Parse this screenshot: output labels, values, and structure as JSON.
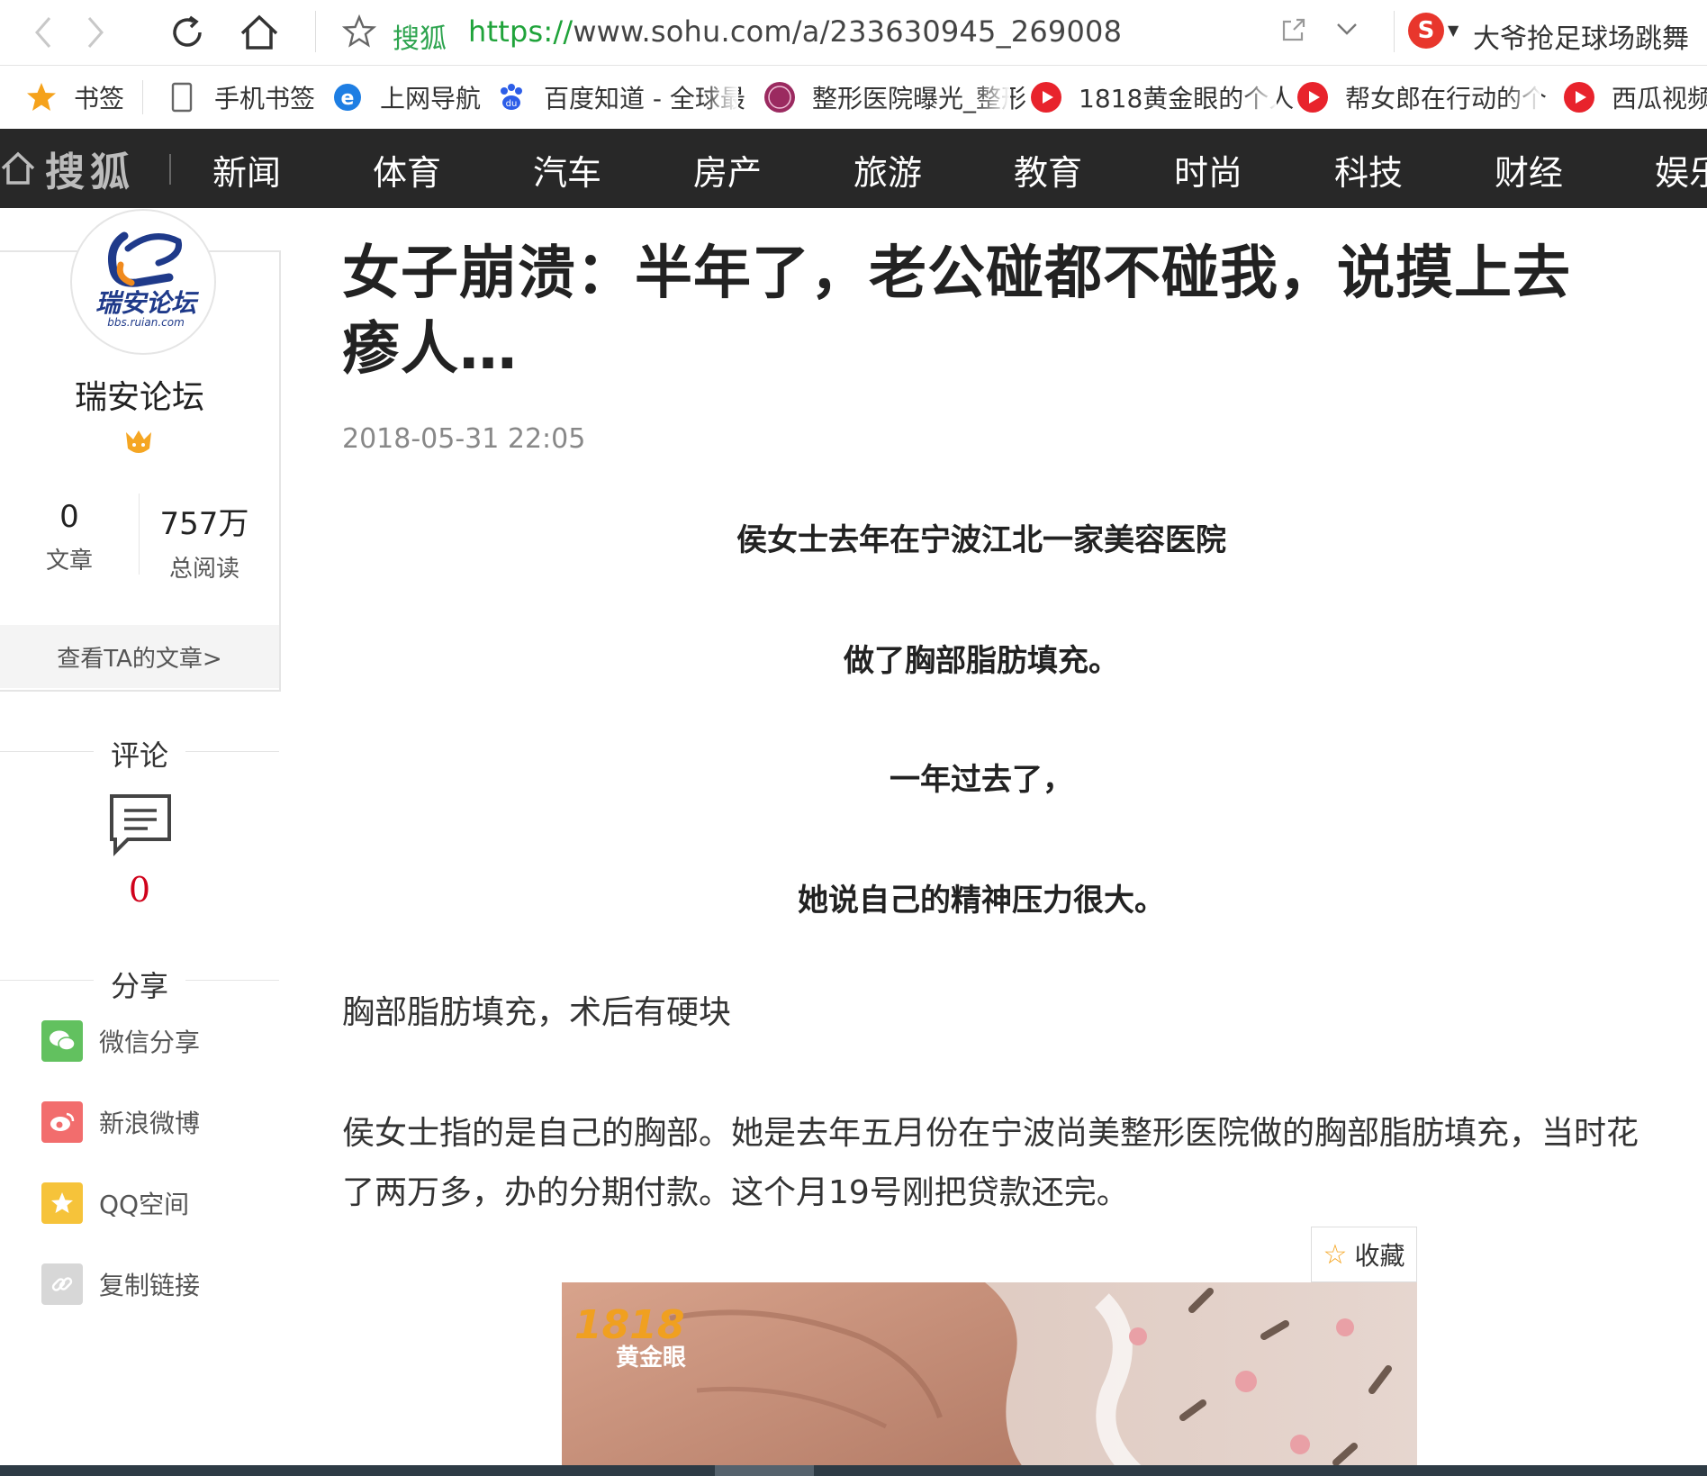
{
  "browser": {
    "address_site": "搜狐",
    "url_protocol": "https://",
    "url_rest": "www.sohu.com/a/233630945_269008",
    "search_engine_text": "大爷抢足球场跳舞"
  },
  "bookmarks": [
    {
      "label": "书签",
      "icon": "star-icon"
    },
    {
      "label": "手机书签",
      "icon": "phone-icon"
    },
    {
      "label": "上网导航",
      "icon": "ie-icon"
    },
    {
      "label": "百度知道 - 全球最",
      "icon": "baidu-icon"
    },
    {
      "label": "整形医院曝光_整形",
      "icon": "clinic-icon"
    },
    {
      "label": "1818黄金眼的个人",
      "icon": "video-icon"
    },
    {
      "label": "帮女郎在行动的个",
      "icon": "video-icon"
    },
    {
      "label": "西瓜视频",
      "icon": "video-icon"
    }
  ],
  "nav": {
    "logo": "搜狐",
    "items": [
      "新闻",
      "体育",
      "汽车",
      "房产",
      "旅游",
      "教育",
      "时尚",
      "科技",
      "财经",
      "娱乐"
    ]
  },
  "author": {
    "avatar_brand": "瑞安论坛",
    "avatar_domain": "bbs.ruian.com",
    "name": "瑞安论坛",
    "articles_count": "0",
    "articles_label": "文章",
    "reads_count": "757万",
    "reads_label": "总阅读",
    "view_link": "查看TA的文章>"
  },
  "comments": {
    "title": "评论",
    "count": "0"
  },
  "share": {
    "title": "分享",
    "items": [
      {
        "label": "微信分享",
        "color": "#62c15f"
      },
      {
        "label": "新浪微博",
        "color": "#f26d6d"
      },
      {
        "label": "QQ空间",
        "color": "#f6c33a"
      },
      {
        "label": "复制链接",
        "color": "#d7d7d7"
      }
    ]
  },
  "article": {
    "title": "女子崩溃：半年了，老公碰都不碰我，说摸上去瘆人…",
    "date": "2018-05-31 22:05",
    "lead_lines": [
      "侯女士去年在宁波江北一家美容医院",
      "做了胸部脂肪填充。",
      "一年过去了，",
      "她说自己的精神压力很大。"
    ],
    "subheading": "胸部脂肪填充，术后有硬块",
    "paragraph": "侯女士指的是自己的胸部。她是去年五月份在宁波尚美整形医院做的胸部脂肪填充，当时花了两万多，办的分期付款。这个月19号刚把贷款还完。",
    "fav_label": "收藏",
    "photo_logo_number": "1818",
    "photo_logo_text": "黄金眼"
  }
}
